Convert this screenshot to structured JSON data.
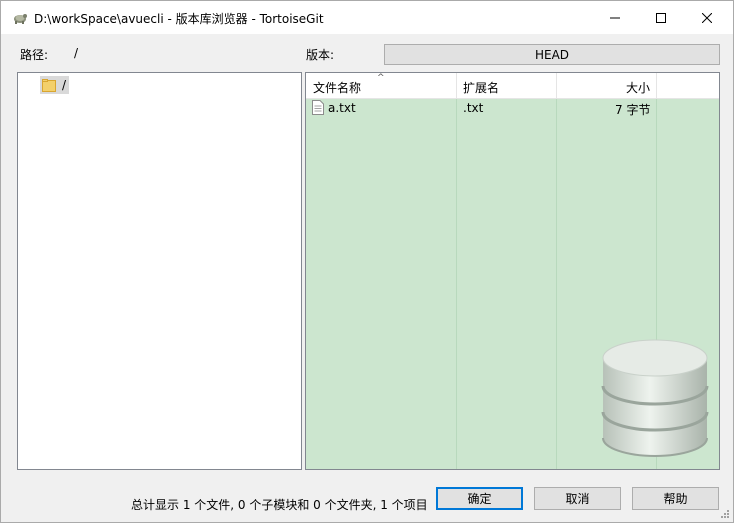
{
  "window": {
    "title": "D:\\workSpace\\avuecli - 版本库浏览器 - TortoiseGit",
    "app_icon": "tortoisegit-icon",
    "controls": {
      "minimize": "minimize-icon",
      "maximize": "maximize-icon",
      "close": "close-icon"
    }
  },
  "path": {
    "label": "路径:",
    "value": "/"
  },
  "version": {
    "label": "版本:",
    "value": "HEAD"
  },
  "tree": {
    "items": [
      {
        "label": "/",
        "icon": "folder-icon"
      }
    ]
  },
  "file_list": {
    "columns": [
      {
        "label": "文件名称"
      },
      {
        "label": "扩展名"
      },
      {
        "label": "大小"
      }
    ],
    "rows": [
      {
        "name": "a.txt",
        "ext": ".txt",
        "size": "7 字节",
        "icon": "text-file-icon"
      }
    ],
    "background_color": "#cce6cf"
  },
  "footer": {
    "summary": "总计显示 1 个文件, 0 个子模块和 0 个文件夹, 1 个项目",
    "ok_label": "确定",
    "cancel_label": "取消",
    "help_label": "帮助"
  },
  "colors": {
    "accent": "#0078d7"
  }
}
